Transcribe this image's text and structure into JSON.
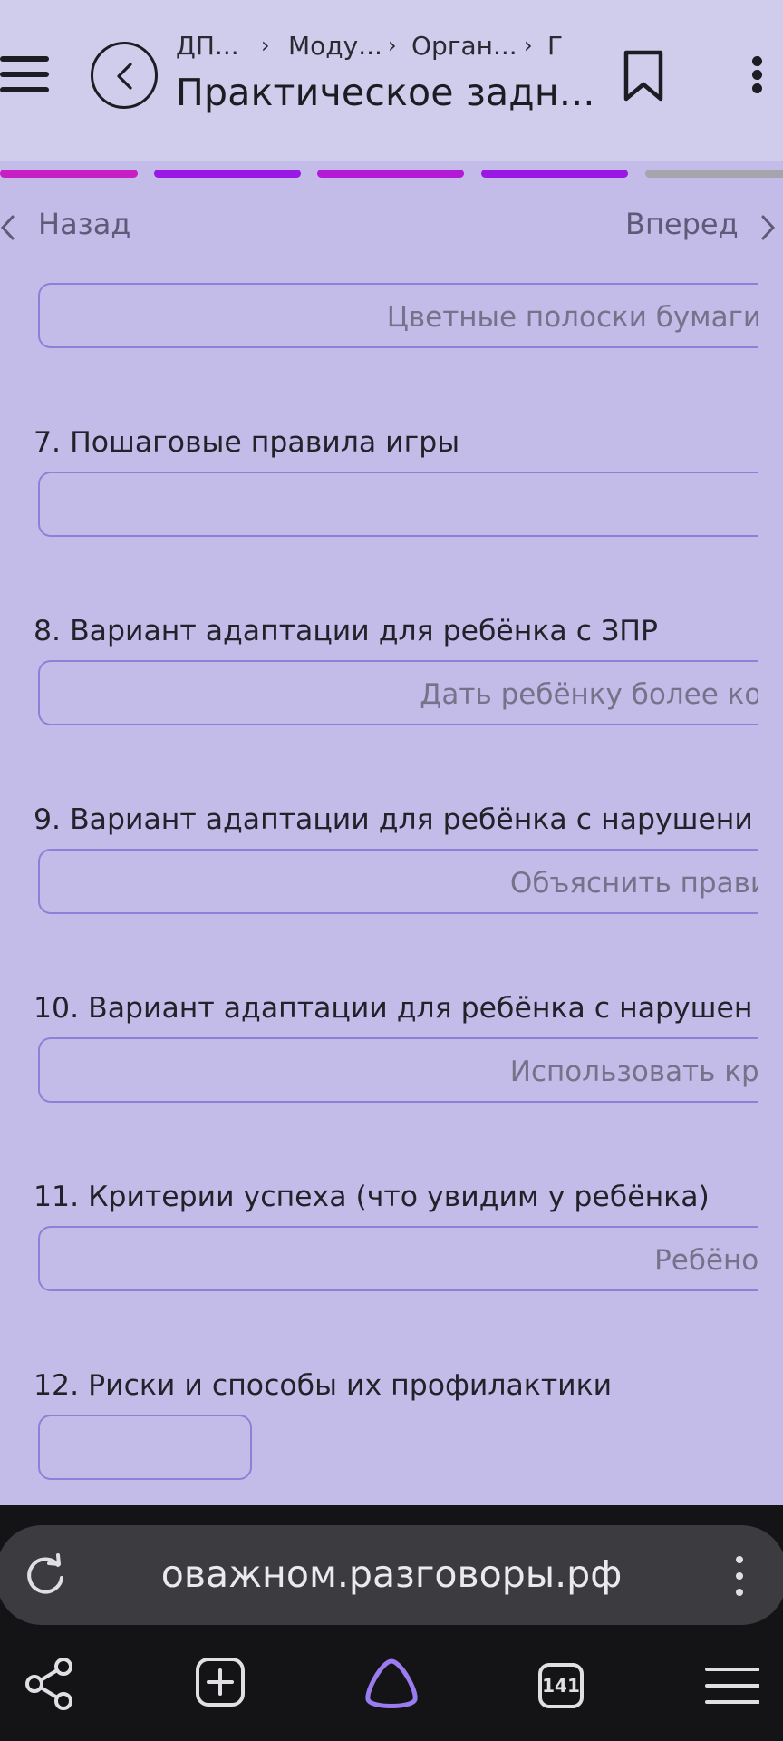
{
  "header": {
    "breadcrumbs": [
      "ДП...",
      "Моду...",
      "Орган...",
      "Г"
    ],
    "title": "Практическое задн..."
  },
  "nav": {
    "back": "Назад",
    "forward": "Вперед"
  },
  "progress_segments": [
    {
      "color": "#c81fc4"
    },
    {
      "color": "#9a17e6"
    },
    {
      "color": "#b41ad6"
    },
    {
      "color": "#9a17e6"
    },
    {
      "color": "#a6a4ad"
    }
  ],
  "form": {
    "field6_value": "Цветные полоски бумаги",
    "q7_label": "7. Пошаговые правила игры",
    "q7_value": "",
    "q8_label": "8. Вариант адаптации для ребёнка с ЗПР",
    "q8_value": "Дать ребёнку более кор",
    "q9_label": "9. Вариант адаптации для ребёнка с нарушени",
    "q9_value": "Объяснить прави",
    "q10_label": "10. Вариант адаптации для ребёнка с нарушен",
    "q10_value": "Использовать кру",
    "q11_label": "11. Критерии успеха (что увидим у ребёнка)",
    "q11_value": "Ребёнок",
    "q12_label": "12. Риски и способы их профилактики",
    "q12_value": ""
  },
  "browser": {
    "url": "оважном.разговоры.рф",
    "tabs_count": "141"
  },
  "colors": {
    "accent": "#8d80d8",
    "page_bg": "#c4bce8",
    "header_bg": "#d0cdec"
  }
}
